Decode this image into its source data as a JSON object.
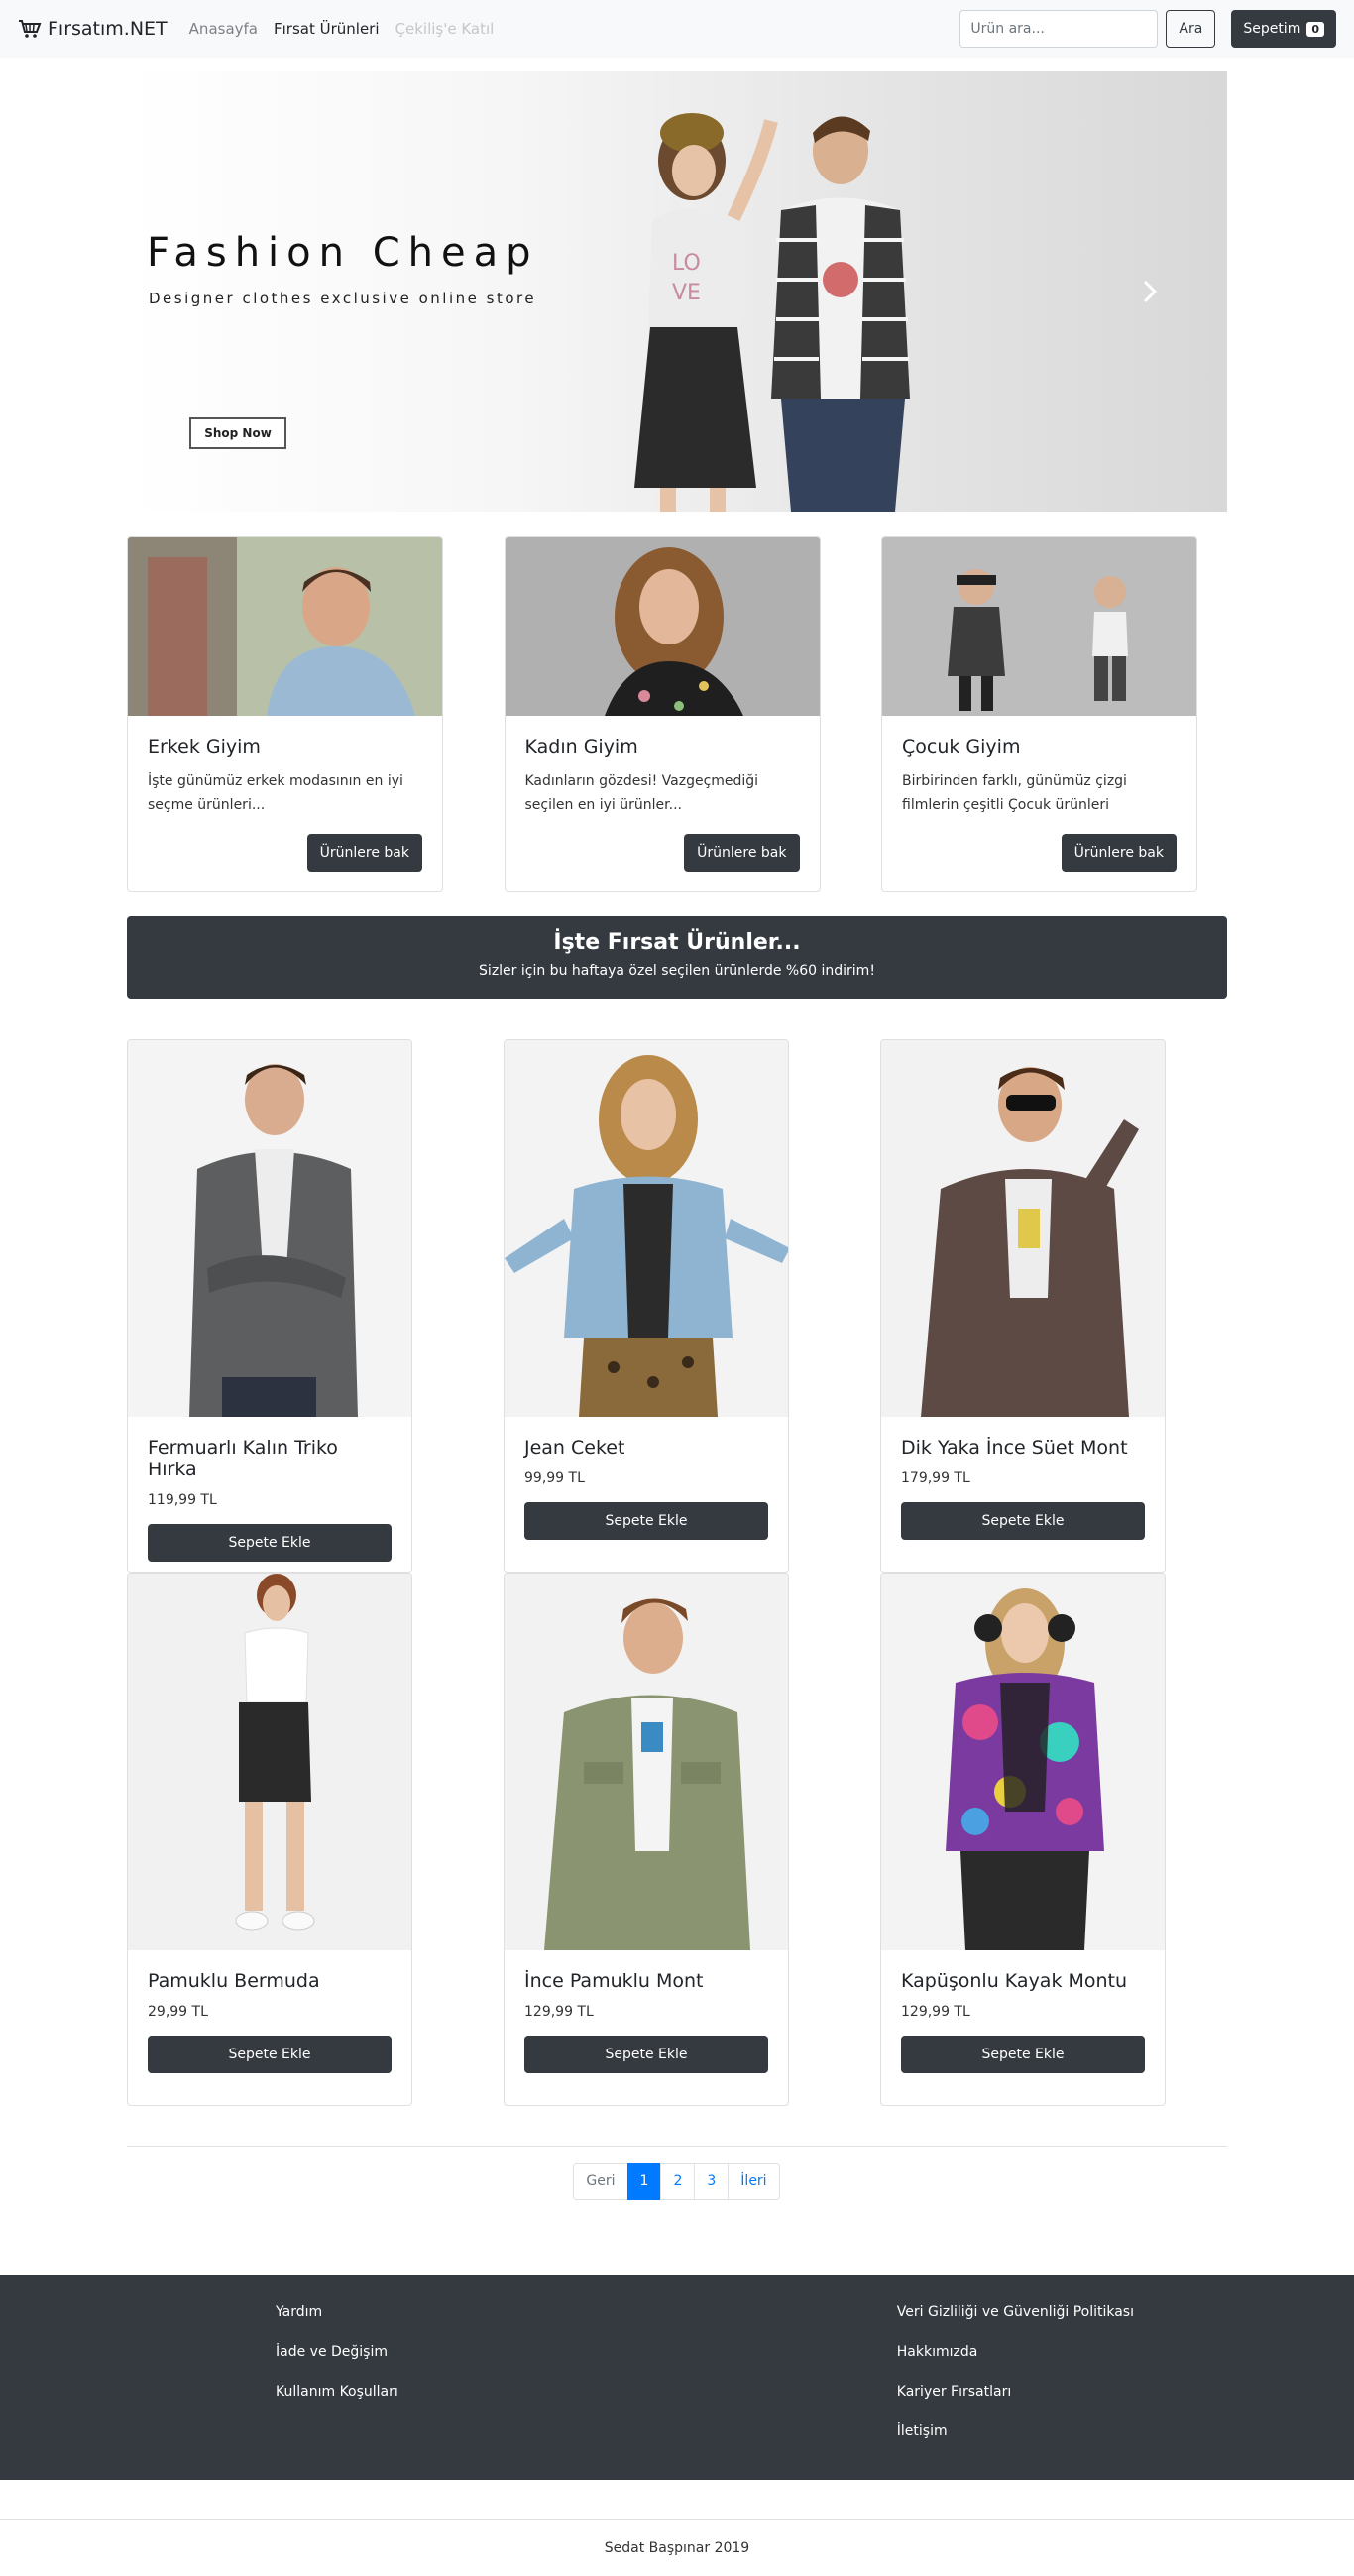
{
  "nav": {
    "brand": "Fırsatım.NET",
    "links": [
      "Anasayfa",
      "Fırsat Ürünleri",
      "Çekiliş'e Katıl"
    ],
    "search_placeholder": "Ürün ara...",
    "search_button": "Ara",
    "cart_label": "Sepetim",
    "cart_count": "0"
  },
  "hero": {
    "title": "Fashion Cheap",
    "subtitle": "Designer clothes exclusive online store",
    "button": "Shop Now"
  },
  "categories": [
    {
      "title": "Erkek Giyim",
      "text": "İşte günümüz erkek modasının en iyi seçme ürünleri...",
      "button": "Ürünlere bak"
    },
    {
      "title": "Kadın Giyim",
      "text": "Kadınların gözdesi! Vazgeçmediği seçilen en iyi ürünler...",
      "button": "Ürünlere bak"
    },
    {
      "title": "Çocuk Giyim",
      "text": "Birbirinden farklı, günümüz çizgi filmlerin çeşitli Çocuk ürünleri",
      "button": "Ürünlere bak"
    }
  ],
  "banner": {
    "title": "İşte Fırsat Ürünler...",
    "subtitle": "Sizler için bu haftaya özel seçilen ürünlerde %60 indirim!"
  },
  "products": [
    {
      "name": "Fermuarlı Kalın Triko Hırka",
      "price": "119,99 TL",
      "button": "Sepete Ekle"
    },
    {
      "name": "Jean Ceket",
      "price": "99,99 TL",
      "button": "Sepete Ekle"
    },
    {
      "name": "Dik Yaka İnce Süet Mont",
      "price": "179,99 TL",
      "button": "Sepete Ekle"
    },
    {
      "name": "Pamuklu Bermuda",
      "price": "29,99 TL",
      "button": "Sepete Ekle"
    },
    {
      "name": "İnce Pamuklu Mont",
      "price": "129,99 TL",
      "button": "Sepete Ekle"
    },
    {
      "name": "Kapüşonlu Kayak Montu",
      "price": "129,99 TL",
      "button": "Sepete Ekle"
    }
  ],
  "pagination": {
    "prev": "Geri",
    "pages": [
      "1",
      "2",
      "3"
    ],
    "next": "İleri"
  },
  "footer": {
    "left_links": [
      "Yardım",
      "İade ve Değişim",
      "Kullanım Koşulları"
    ],
    "right_links": [
      "Veri Gizliliği ve Güvenliği Politikası",
      "Hakkımızda",
      "Kariyer Fırsatları",
      "İletişim"
    ],
    "copyright": "Sedat Başpınar 2019"
  }
}
